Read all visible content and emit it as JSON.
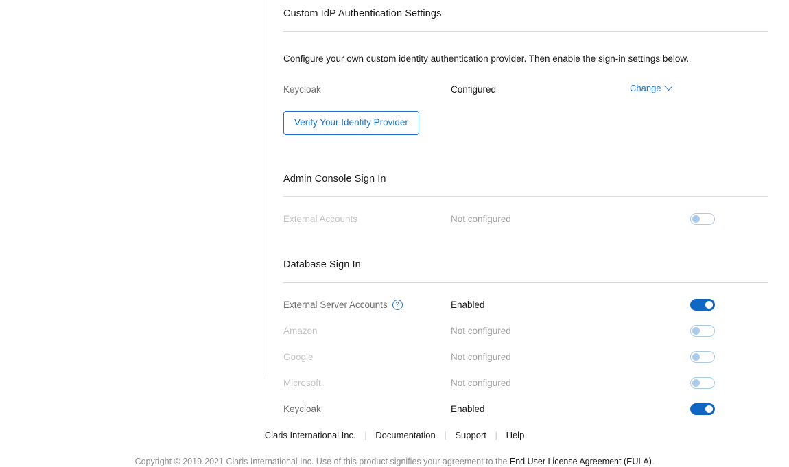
{
  "colors": {
    "accent": "#1a73c8",
    "toggle_on": "#1068c4",
    "toggle_off_border": "#a9cbec",
    "text": "#1a1a1a",
    "muted": "#6e6e6e",
    "disabled": "#c3c3c3"
  },
  "idp_section": {
    "title": "Custom IdP Authentication Settings",
    "description": "Configure your own custom identity authentication provider. Then enable the sign-in settings below.",
    "row": {
      "label": "Keycloak",
      "status": "Configured",
      "change_label": "Change",
      "chevron_icon": "chevron-down-icon"
    },
    "verify_button": "Verify Your Identity Provider"
  },
  "admin_console_section": {
    "title": "Admin Console Sign In",
    "rows": [
      {
        "label": "External Accounts",
        "status": "Not configured",
        "enabled": false,
        "dim": true
      }
    ]
  },
  "database_section": {
    "title": "Database Sign In",
    "rows": [
      {
        "label": "External Server Accounts",
        "status": "Enabled",
        "enabled": true,
        "dim": false,
        "help_icon": "?"
      },
      {
        "label": "Amazon",
        "status": "Not configured",
        "enabled": false,
        "dim": true
      },
      {
        "label": "Google",
        "status": "Not configured",
        "enabled": false,
        "dim": true
      },
      {
        "label": "Microsoft",
        "status": "Not configured",
        "enabled": false,
        "dim": true
      },
      {
        "label": "Keycloak",
        "status": "Enabled",
        "enabled": true,
        "dim": false
      }
    ]
  },
  "footer": {
    "links": [
      "Claris International Inc.",
      "Documentation",
      "Support",
      "Help"
    ],
    "separator": "|",
    "copyright_prefix": "Copyright © 2019-2021 Claris International Inc. Use of this product signifies your agreement to the ",
    "eula_link": "End User License Agreement (EULA)",
    "copyright_suffix": "."
  }
}
